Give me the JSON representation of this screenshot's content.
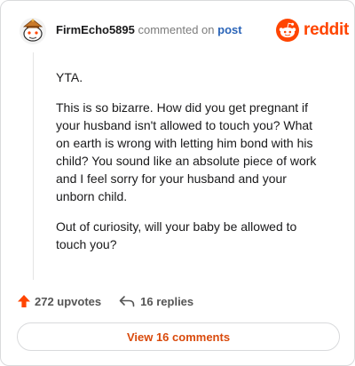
{
  "header": {
    "username": "FirmEcho5895",
    "commented_text": "commented on",
    "post_link": "post"
  },
  "brand": {
    "wordmark": "reddit",
    "color": "#ff4500",
    "icon": "reddit-snoo-icon"
  },
  "comment": {
    "paragraphs": [
      "YTA.",
      "This is so bizarre. How did you get pregnant if your husband isn't allowed to touch you? What on earth is wrong with letting him bond with his child? You sound like an absolute piece of work and I feel sorry for your husband and your unborn child.",
      "Out of curiosity, will your baby be allowed to touch you?"
    ]
  },
  "actions": {
    "upvotes": "272 upvotes",
    "replies": "16 replies",
    "upvote_icon": "upvote-arrow-icon",
    "reply_icon": "reply-arrow-icon",
    "upvote_color": "#ff4500"
  },
  "footer": {
    "view_comments": "View 16 comments",
    "accent": "#d94a0c"
  }
}
